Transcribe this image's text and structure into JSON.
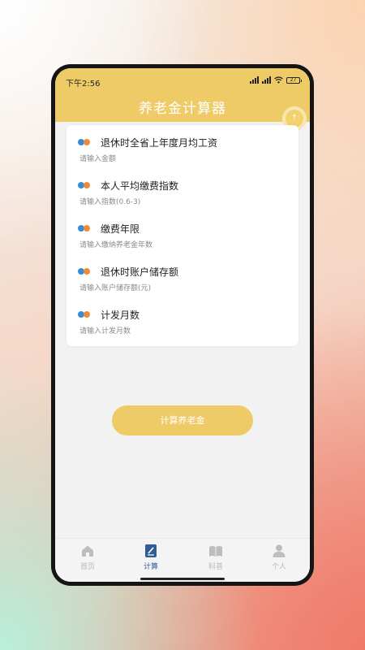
{
  "status_bar": {
    "time": "下午2:56",
    "battery": "27"
  },
  "header": {
    "title": "养老金计算器"
  },
  "float_button": {
    "icon": "arrow-up-icon",
    "glyph": "⇡"
  },
  "form": {
    "fields": [
      {
        "label": "退休时全省上年度月均工资",
        "placeholder": "请输入金额",
        "value": ""
      },
      {
        "label": "本人平均缴费指数",
        "placeholder": "请输入指数(0.6-3)",
        "value": ""
      },
      {
        "label": "缴费年限",
        "placeholder": "请输入缴纳养老金年数",
        "value": ""
      },
      {
        "label": "退休时账户储存额",
        "placeholder": "请输入账户储存额(元)",
        "value": ""
      },
      {
        "label": "计发月数",
        "placeholder": "请输入计发月数",
        "value": ""
      }
    ]
  },
  "calculate_button": {
    "label": "计算养老金"
  },
  "tabbar": {
    "items": [
      {
        "label": "首页",
        "icon": "home-icon",
        "active": false
      },
      {
        "label": "计算",
        "icon": "calculator-icon",
        "active": true
      },
      {
        "label": "科普",
        "icon": "book-icon",
        "active": false
      },
      {
        "label": "个人",
        "icon": "person-icon",
        "active": false
      }
    ]
  },
  "colors": {
    "accent": "#efcb68",
    "active_tab": "#2f5e96",
    "dot_blue": "#3a8ad8",
    "dot_orange": "#ef8a3a"
  }
}
